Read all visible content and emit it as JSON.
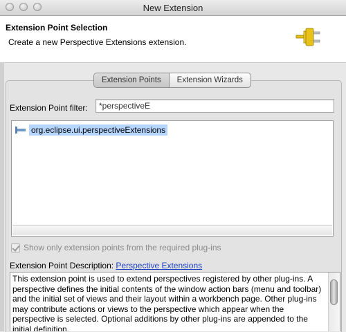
{
  "window": {
    "title": "New Extension"
  },
  "banner": {
    "title": "Extension Point Selection",
    "description": "Create a new Perspective Extensions extension."
  },
  "tabs": [
    {
      "label": "Extension Points",
      "active": true
    },
    {
      "label": "Extension Wizards",
      "active": false
    }
  ],
  "filter": {
    "label": "Extension Point filter:",
    "value": "*perspectiveE"
  },
  "list": {
    "items": [
      {
        "label": "org.eclipse.ui.perspectiveExtensions",
        "selected": true
      }
    ]
  },
  "checkbox": {
    "label": "Show only extension points from the required plug-ins",
    "checked": true,
    "enabled": false
  },
  "description": {
    "label": "Extension Point Description:",
    "link": "Perspective Extensions",
    "text": "This extension point is used to extend perspectives registered by other plug-ins. A perspective defines the initial contents of the window action bars (menu and toolbar) and the initial set of views and their layout within a workbench page. Other plug-ins may contribute actions or views to the perspective which appear when the perspective is selected. Optional additions by other plug-ins are appended to the initial definition."
  },
  "colors": {
    "selection": "#b5d5ff",
    "link": "#1a3cbf",
    "plug": "#e8c21a"
  },
  "icons": [
    "plug-icon",
    "extension-point-icon",
    "check-icon"
  ]
}
